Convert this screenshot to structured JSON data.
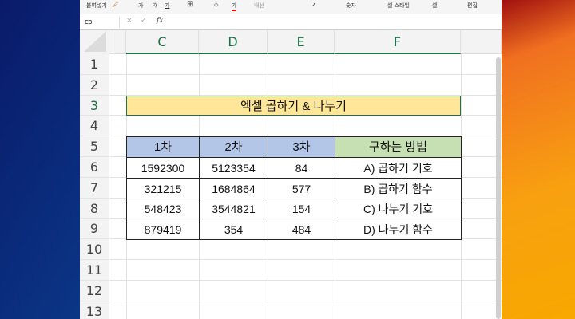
{
  "ribbon": {
    "paste": "붙여넣기",
    "bold": "가",
    "italic": "가",
    "underline": "가",
    "wrap": "내선",
    "number": "숫자",
    "cell_styles": "셀 스타일",
    "cells": "셀",
    "editing": "편집"
  },
  "formula_bar": {
    "name_box": "C3",
    "cancel": "×",
    "enter": "✓",
    "fx": "fx",
    "value": ""
  },
  "columns": [
    "C",
    "D",
    "E",
    "F"
  ],
  "rows": [
    "1",
    "2",
    "3",
    "4",
    "5",
    "6",
    "7",
    "8",
    "9",
    "10",
    "11",
    "12",
    "13"
  ],
  "title": "엑셀 곱하기 & 나누기",
  "table": {
    "headers": [
      "1차",
      "2차",
      "3차",
      "구하는 방법"
    ],
    "rows": [
      [
        "1592300",
        "5123354",
        "84",
        "A) 곱하기 기호"
      ],
      [
        "321215",
        "1684864",
        "577",
        "B) 곱하기 함수"
      ],
      [
        "548423",
        "3544821",
        "154",
        "C) 나누기 기호"
      ],
      [
        "879419",
        "354",
        "484",
        "D) 나누기 함수"
      ]
    ]
  },
  "colors": {
    "title_fill": "#ffe699",
    "header_fill": "#b4c6e7",
    "method_fill": "#c6e0b4",
    "accent": "#1e7145"
  }
}
